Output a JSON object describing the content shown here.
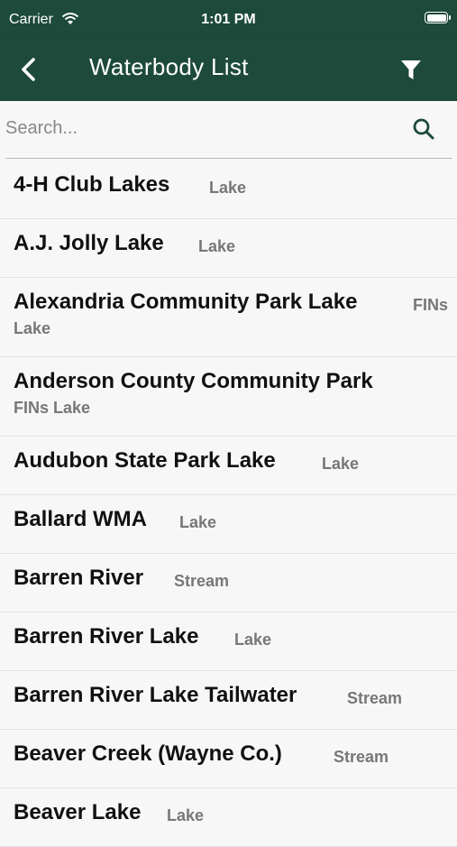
{
  "status_bar": {
    "carrier": "Carrier",
    "time": "1:01 PM"
  },
  "nav": {
    "title": "Waterbody List"
  },
  "search": {
    "placeholder": "Search..."
  },
  "colors": {
    "header_bg": "#1d4a3b",
    "search_icon": "#1d4a3b",
    "type_text": "#777777"
  },
  "items": [
    {
      "name": "4-H Club Lakes",
      "type": "Lake"
    },
    {
      "name": "A.J. Jolly Lake",
      "type": "Lake"
    },
    {
      "name": "Alexandria Community Park Lake",
      "type": "FINs Lake"
    },
    {
      "name": "Anderson County Community Park",
      "type": "FINs Lake"
    },
    {
      "name": "Audubon State Park Lake",
      "type": "Lake"
    },
    {
      "name": "Ballard WMA",
      "type": "Lake"
    },
    {
      "name": "Barren River",
      "type": "Stream"
    },
    {
      "name": "Barren River Lake",
      "type": "Lake"
    },
    {
      "name": "Barren River Lake Tailwater",
      "type": "Stream"
    },
    {
      "name": "Beaver Creek (Wayne Co.)",
      "type": "Stream"
    },
    {
      "name": "Beaver Lake",
      "type": "Lake"
    }
  ]
}
